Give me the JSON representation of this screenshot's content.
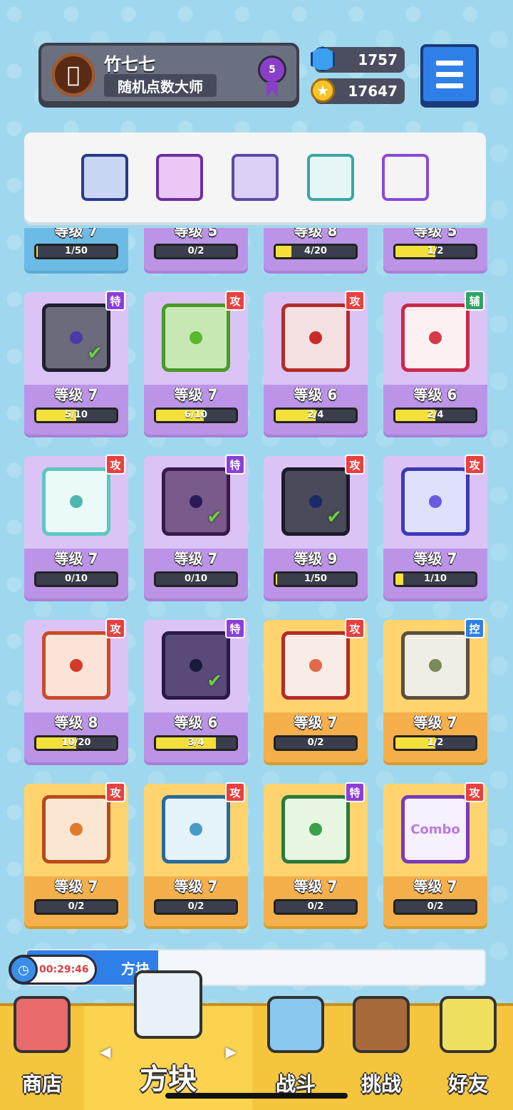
{
  "profile": {
    "name": "竹七七",
    "title": "随机点数大师",
    "rank": "5",
    "avatar_icon": "apple-logo"
  },
  "currency": {
    "gems": "1757",
    "coins": "17647"
  },
  "menu": {
    "icon": "hamburger-menu-icon"
  },
  "equipped_dice": [
    "gear",
    "arrow",
    "crack",
    "heal",
    "rainbow"
  ],
  "colors": {
    "attack": "#e94040",
    "special": "#8b3fd8",
    "support": "#2ea363",
    "control": "#2f7fe8"
  },
  "partial_row": [
    {
      "level": "等级 7",
      "progress": "1/50",
      "fill": 0.02
    },
    {
      "level": "等级 5",
      "progress": "0/2",
      "fill": 0
    },
    {
      "level": "等级 8",
      "progress": "4/20",
      "fill": 0.2
    },
    {
      "level": "等级 5",
      "progress": "1/2",
      "fill": 0.5
    }
  ],
  "cards": [
    {
      "tag": "特",
      "level": "等级 7",
      "progress": "5/10",
      "fill": 0.5,
      "checked": true
    },
    {
      "tag": "攻",
      "level": "等级 7",
      "progress": "6/10",
      "fill": 0.6,
      "checked": false
    },
    {
      "tag": "攻",
      "level": "等级 6",
      "progress": "2/4",
      "fill": 0.5,
      "checked": false
    },
    {
      "tag": "辅",
      "level": "等级 6",
      "progress": "2/4",
      "fill": 0.5,
      "checked": false
    },
    {
      "tag": "攻",
      "level": "等级 7",
      "progress": "0/10",
      "fill": 0,
      "checked": false
    },
    {
      "tag": "特",
      "level": "等级 7",
      "progress": "0/10",
      "fill": 0,
      "checked": true
    },
    {
      "tag": "攻",
      "level": "等级 9",
      "progress": "1/50",
      "fill": 0.02,
      "checked": true
    },
    {
      "tag": "攻",
      "level": "等级 7",
      "progress": "1/10",
      "fill": 0.1,
      "checked": false
    },
    {
      "tag": "攻",
      "level": "等级 8",
      "progress": "10/20",
      "fill": 0.5,
      "checked": false
    },
    {
      "tag": "特",
      "level": "等级 6",
      "progress": "3/4",
      "fill": 0.75,
      "checked": true
    },
    {
      "tag": "攻",
      "level": "等级 7",
      "progress": "0/2",
      "fill": 0,
      "checked": false
    },
    {
      "tag": "控",
      "level": "等级 7",
      "progress": "1/2",
      "fill": 0.5,
      "checked": false
    },
    {
      "tag": "攻",
      "level": "等级 7",
      "progress": "0/2",
      "fill": 0,
      "checked": false
    },
    {
      "tag": "攻",
      "level": "等级 7",
      "progress": "0/2",
      "fill": 0,
      "checked": false
    },
    {
      "tag": "特",
      "level": "等级 7",
      "progress": "0/2",
      "fill": 0,
      "checked": false
    },
    {
      "tag": "攻",
      "level": "等级 7",
      "progress": "0/2",
      "fill": 0,
      "checked": false
    }
  ],
  "combo_text": "Combo",
  "event": {
    "timer": "00:29:46",
    "label": "方块"
  },
  "nav": [
    {
      "label": "商店",
      "icon": "shop-icon"
    },
    {
      "label": "方块",
      "icon": "dice-icon"
    },
    {
      "label": "战斗",
      "icon": "battle-icon"
    },
    {
      "label": "挑战",
      "icon": "challenge-icon"
    },
    {
      "label": "好友",
      "icon": "friend-icon"
    }
  ]
}
